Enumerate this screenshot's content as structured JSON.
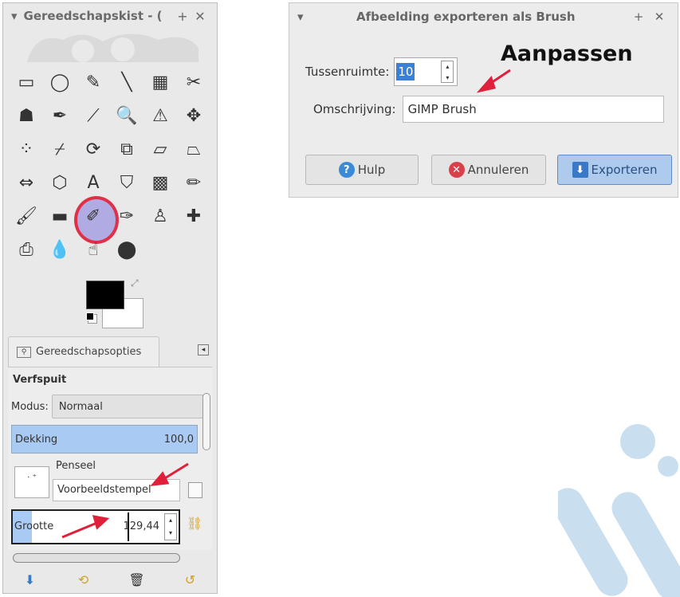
{
  "toolbox": {
    "title": "Gereedschapskist - (",
    "title_add": "+",
    "title_close": "✕",
    "options_tab": "Gereedschapsopties",
    "tool_name": "Verfspuit",
    "mode_label": "Modus:",
    "mode_value": "Normaal",
    "opacity_label": "Dekking",
    "opacity_value": "100,0",
    "brush_label": "Penseel",
    "brush_name": "Voorbeeldstempel",
    "size_label": "Grootte",
    "size_value": "129,44",
    "tools": [
      {
        "name": "rect-select-icon",
        "glyph": "▭"
      },
      {
        "name": "ellipse-select-icon",
        "glyph": "◯"
      },
      {
        "name": "lasso-icon",
        "glyph": "✎"
      },
      {
        "name": "fuzzy-select-icon",
        "glyph": "╲"
      },
      {
        "name": "by-color-select-icon",
        "glyph": "▦"
      },
      {
        "name": "scissors-icon",
        "glyph": "✂"
      },
      {
        "name": "foreground-select-icon",
        "glyph": "☗"
      },
      {
        "name": "paths-icon",
        "glyph": "✒"
      },
      {
        "name": "color-picker-icon",
        "glyph": "⟋"
      },
      {
        "name": "zoom-icon",
        "glyph": "🔍"
      },
      {
        "name": "measure-icon",
        "glyph": "⚠"
      },
      {
        "name": "move-icon",
        "glyph": "✥"
      },
      {
        "name": "align-icon",
        "glyph": "⁘"
      },
      {
        "name": "crop-icon",
        "glyph": "⌿"
      },
      {
        "name": "rotate-icon",
        "glyph": "⟳"
      },
      {
        "name": "scale-icon",
        "glyph": "⧉"
      },
      {
        "name": "shear-icon",
        "glyph": "▱"
      },
      {
        "name": "perspective-icon",
        "glyph": "⏢"
      },
      {
        "name": "flip-icon",
        "glyph": "⇔"
      },
      {
        "name": "cage-icon",
        "glyph": "⬡"
      },
      {
        "name": "text-icon",
        "glyph": "A"
      },
      {
        "name": "bucket-fill-icon",
        "glyph": "⛉"
      },
      {
        "name": "blend-icon",
        "glyph": "▩"
      },
      {
        "name": "pencil-icon",
        "glyph": "✏"
      },
      {
        "name": "paintbrush-icon",
        "glyph": "🖌"
      },
      {
        "name": "eraser-icon",
        "glyph": "▬"
      },
      {
        "name": "airbrush-icon",
        "glyph": "✐"
      },
      {
        "name": "ink-icon",
        "glyph": "✑"
      },
      {
        "name": "clone-icon",
        "glyph": "♙"
      },
      {
        "name": "heal-icon",
        "glyph": "✚"
      },
      {
        "name": "perspective-clone-icon",
        "glyph": "⎙"
      },
      {
        "name": "blur-icon",
        "glyph": "💧"
      },
      {
        "name": "smudge-icon",
        "glyph": "☝"
      },
      {
        "name": "dodge-burn-icon",
        "glyph": "⬤"
      }
    ],
    "active_tool": 26
  },
  "dialog": {
    "title": "Afbeelding exporteren als Brush",
    "title_add": "+",
    "title_close": "✕",
    "spacing_label": "Tussenruimte:",
    "spacing_value": "10",
    "description_label": "Omschrijving:",
    "description_value": "GIMP Brush",
    "annotation": "Aanpassen",
    "help_label": "Hulp",
    "cancel_label": "Annuleren",
    "export_label": "Exporteren"
  },
  "colors": {
    "accent": "#a9caf2",
    "highlight_ring": "#e03048",
    "arrow": "#e0203a",
    "watermark": "#c9dff0"
  }
}
